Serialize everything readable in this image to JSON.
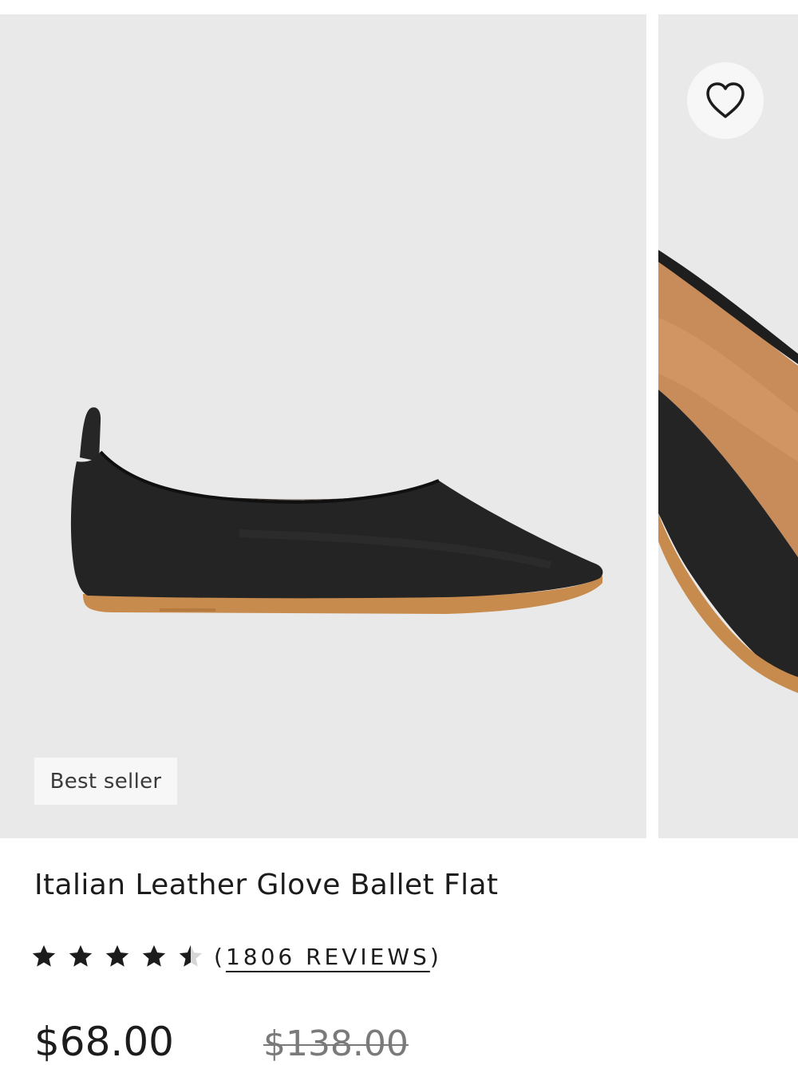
{
  "product": {
    "badge": "Best seller",
    "title": "Italian Leather Glove Ballet Flat",
    "rating": 4.5,
    "rating_max": 5,
    "reviews_open": "(",
    "reviews_text": "1806 REVIEWS",
    "reviews_close": ")",
    "price": "$68.00",
    "original_price": "$138.00"
  },
  "gallery": {
    "images": [
      {
        "subject": "black leather ballet flat, side view",
        "icon": "shoe-image"
      },
      {
        "subject": "black leather ballet flat, close-up",
        "icon": "shoe-image"
      }
    ],
    "favorite_icon": "heart-icon"
  },
  "colors": {
    "image_background": "#e9e9e9",
    "shoe_leather": "#242424",
    "sole": "#c88b4e",
    "text": "#1c1c1c",
    "muted_price": "#7a7a7a"
  }
}
